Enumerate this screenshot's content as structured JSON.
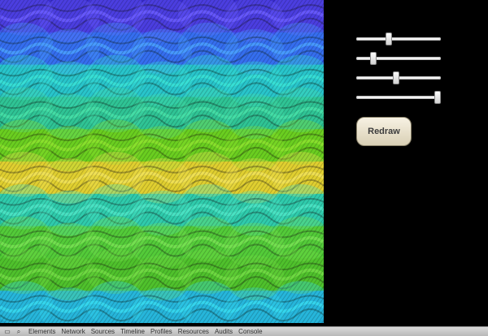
{
  "canvas": {
    "bands": [
      {
        "color": "#3b2ed0",
        "accent": "#6b5cff"
      },
      {
        "color": "#2a53e6",
        "accent": "#4aa0ff"
      },
      {
        "color": "#1fb6c5",
        "accent": "#39e1d7"
      },
      {
        "color": "#22b58b",
        "accent": "#47e0a8"
      },
      {
        "color": "#58c31a",
        "accent": "#8de32f"
      },
      {
        "color": "#d7c51b",
        "accent": "#f1e15a"
      },
      {
        "color": "#1fbe9f",
        "accent": "#4de5c6"
      },
      {
        "color": "#3fbf2c",
        "accent": "#78e353"
      },
      {
        "color": "#3db31f",
        "accent": "#72dc45"
      },
      {
        "color": "#1ea4cf",
        "accent": "#37d9f1"
      }
    ]
  },
  "controls": {
    "sliders": [
      {
        "name": "slider-1",
        "value": 0.38
      },
      {
        "name": "slider-2",
        "value": 0.2
      },
      {
        "name": "slider-3",
        "value": 0.47
      },
      {
        "name": "slider-4",
        "value": 0.96
      }
    ],
    "redraw_label": "Redraw"
  },
  "devtools": {
    "tabs": [
      "Elements",
      "Network",
      "Sources",
      "Timeline",
      "Profiles",
      "Resources",
      "Audits",
      "Console"
    ]
  }
}
